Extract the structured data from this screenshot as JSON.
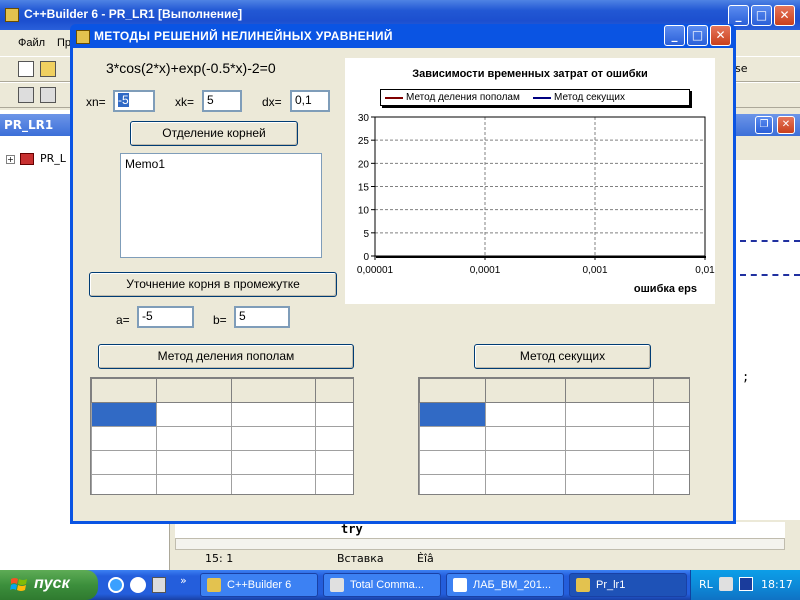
{
  "ide": {
    "title": "C++Builder 6 - PR_LR1 [Выполнение]",
    "menu": [
      "Файл",
      "Пр"
    ],
    "left_panel_title": "PR_LR1",
    "tree_item": "PR_L",
    "right_snippets": [
      "se"
    ],
    "code_line": "try",
    "code_tail": ";",
    "status": {
      "position": "15:  1",
      "mode": "Вставка",
      "tab": "Ѐîâ"
    }
  },
  "dialog": {
    "title": "МЕТОДЫ РЕШЕНИЙ НЕЛИНЕЙНЫХ УРАВНЕНИЙ",
    "equation": "3*cos(2*x)+exp(-0.5*x)-2=0",
    "xn_label": "xn=",
    "xn_value": "-5",
    "xk_label": "xk=",
    "xk_value": "5",
    "dx_label": "dx=",
    "dx_value": "0,1",
    "separate_button": "Отделение корней",
    "memo_text": "Memo1",
    "refine_button": "Уточнение корня в промежутке",
    "a_label": "a=",
    "a_value": "-5",
    "b_label": "b=",
    "b_value": "5",
    "bisection_button": "Метод деления пополам",
    "secant_button": "Метод секущих"
  },
  "chart_data": {
    "type": "line",
    "title": "Зависимости временных затрат от ошибки",
    "xlabel": "ошибка eps",
    "ylabel": "",
    "x_tick_labels": [
      "0,00001",
      "0,0001",
      "0,001",
      "0,01"
    ],
    "x_log_scale": true,
    "ylim": [
      0,
      30
    ],
    "y_ticks": [
      0,
      5,
      10,
      15,
      20,
      25,
      30
    ],
    "grid": true,
    "legend_position": "top",
    "series": [
      {
        "name": "Метод деления пополам",
        "color": "#800000",
        "values": []
      },
      {
        "name": "Метод секущих",
        "color": "#000080",
        "values": []
      }
    ]
  },
  "taskbar": {
    "start_label": "пуск",
    "tasks": [
      "C++Builder 6",
      "Total Comma...",
      "ЛАБ_ВМ_201...",
      "Pr_lr1"
    ],
    "lang": "RL",
    "clock": "18:17"
  },
  "colors": {
    "xp_blue": "#0a54e3",
    "selection": "#316ac5",
    "face": "#ece9d8"
  }
}
